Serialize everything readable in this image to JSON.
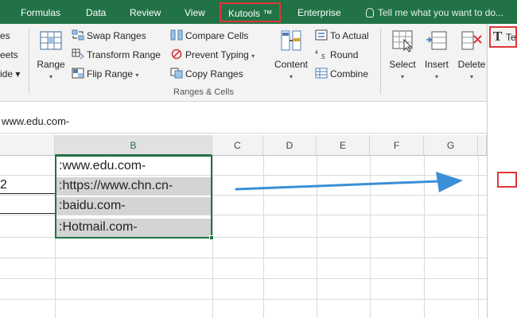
{
  "menu_tabs": [
    "Formulas",
    "Data",
    "Review",
    "View",
    "Kutools ™",
    "Enterprise"
  ],
  "tell_me": "Tell me what you want to do...",
  "ribbon": {
    "left_cut": [
      "es",
      "eets",
      "ide ▾"
    ],
    "range_label": "Range",
    "ranges_cells": {
      "swap_ranges": "Swap Ranges",
      "transform_range": "Transform Range",
      "flip_range": "Flip Range",
      "compare_cells": "Compare Cells",
      "prevent_typing": "Prevent Typing",
      "copy_ranges": "Copy Ranges",
      "content": "Content",
      "to_actual": "To Actual",
      "round": "Round",
      "combine": "Combine",
      "group_label": "Ranges & Cells"
    },
    "select_label": "Select",
    "insert_label": "Insert",
    "delete_label": "Delete",
    "text_button": "Te"
  },
  "formula_value": "www.edu.com-",
  "columns": [
    "B",
    "C",
    "D",
    "E",
    "F",
    "G"
  ],
  "colA_cut": [
    "",
    "2",
    "",
    ""
  ],
  "colB": [
    ":www.edu.com-",
    ":https://www.chn.cn-",
    ":baidu.com-",
    ":Hotmail.com-"
  ],
  "colors": {
    "accent": "#217346",
    "highlight_red": "#e0363a",
    "arrow_blue": "#3a8fd6",
    "selected_fill": "#d4d4d4"
  }
}
